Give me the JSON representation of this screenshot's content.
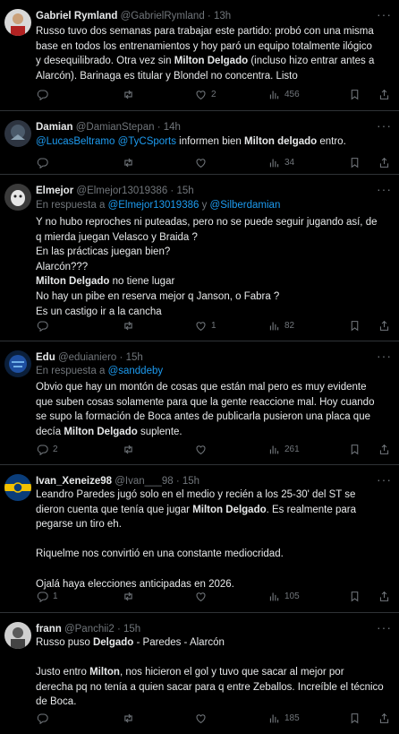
{
  "colors": {
    "background": "#000000",
    "text": "#e7e9ea",
    "muted": "#71767b",
    "link": "#1d9bf0",
    "divider": "#2f3336"
  },
  "tweets": [
    {
      "name": "Gabriel Rymland",
      "handle": "@GabrielRymland",
      "time": "13h",
      "lines": [
        "Russo tuvo dos semanas para trabajar este partido: probó con una misma",
        "base en todos los entrenamientos y hoy paró un equipo totalmente ilógico",
        "y desequilibrado. Otra vez sin ",
        "Milton Delgado",
        " (incluso hizo entrar antes a",
        "Alarcón). Barinaga es titular y Blondel no concentra. Listo"
      ],
      "replies": "",
      "retweets": "",
      "likes": "2",
      "views": "456"
    },
    {
      "name": "Damian",
      "handle": "@DamianStepan",
      "time": "14h",
      "mention1": "@LucasBeltramo",
      "mention2": "@TyCSports",
      "text_pre": " informen bien ",
      "bold": "Milton delgado",
      "text_post": " entro.",
      "replies": "",
      "retweets": "",
      "likes": "",
      "views": "34"
    },
    {
      "name": "Elmejor",
      "handle": "@Elmejor13019386",
      "time": "15h",
      "reply_label": "En respuesta a",
      "reply_to1": "@Elmejor13019386",
      "reply_and": "y",
      "reply_to2": "@Silberdamian",
      "lines": [
        "Y no hubo reproches ni puteadas, pero no se puede seguir jugando así,  de",
        "q mierda juegan Velasco y Braida ?",
        "En las prácticas juegan bien?",
        "Alarcón???",
        "Milton Delgado",
        " no tiene lugar",
        "No hay un pibe en reserva mejor q Janson, o Fabra ?",
        "Es un castigo ir a la cancha"
      ],
      "replies": "",
      "retweets": "",
      "likes": "1",
      "views": "82"
    },
    {
      "name": "Edu",
      "handle": "@eduianiero",
      "time": "15h",
      "reply_label": "En respuesta a",
      "reply_to1": "@sanddeby",
      "lines": [
        "Obvio que hay un montón de cosas que están mal pero es muy evidente",
        "que suben cosas solamente para que la gente reaccione mal. Hoy cuando",
        "se supo la formación de Boca antes de publicarla pusieron una placa que",
        "decía ",
        "Milton Delgado",
        " suplente."
      ],
      "replies": "2",
      "retweets": "",
      "likes": "",
      "views": "261"
    },
    {
      "name": "Ivan_Xeneize98",
      "handle": "@Ivan___98",
      "time": "15h",
      "lines": [
        "Leandro Paredes jugó solo en el medio y recién a los 25-30' del ST se",
        "dieron cuenta que tenía que jugar ",
        "Milton Delgado",
        ". Es realmente para",
        "pegarse un tiro eh.",
        "Riquelme nos convirtió en una constante mediocridad.",
        "Ojalá haya elecciones anticipadas en 2026."
      ],
      "replies": "1",
      "retweets": "",
      "likes": "",
      "views": "105"
    },
    {
      "name": "frann",
      "handle": "@Panchii2",
      "time": "15h",
      "lines": [
        "Russo puso ",
        "Delgado",
        " - Paredes - Alarcón",
        "Justo entro ",
        "Milton",
        ", nos hicieron el gol y tuvo que sacar al mejor por",
        "derecha pq no tenía a quien sacar para q entre Zeballos. Increíble el técnico",
        "de Boca."
      ],
      "replies": "",
      "retweets": "",
      "likes": "",
      "views": "185"
    }
  ]
}
